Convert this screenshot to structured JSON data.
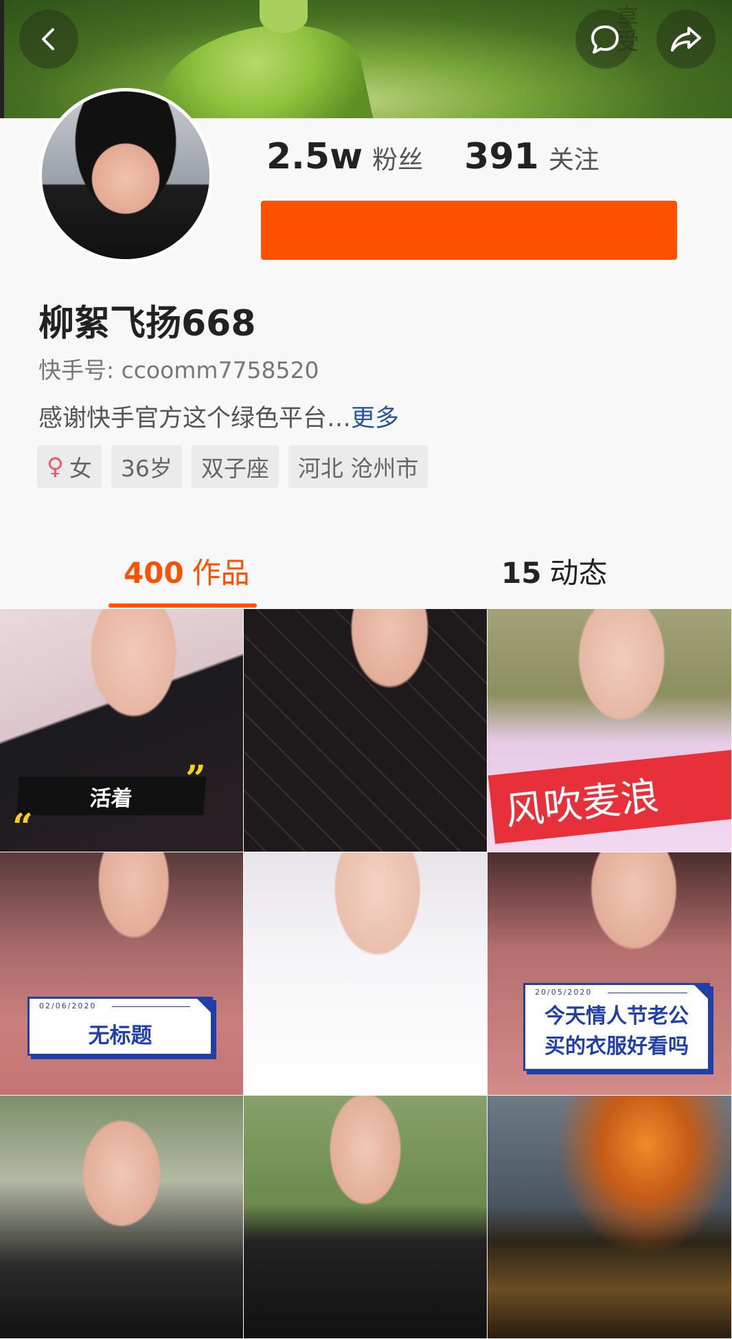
{
  "profile": {
    "fans_count": "2.5w",
    "fans_label": "粉丝",
    "following_count": "391",
    "following_label": "关注",
    "name": "柳絮飞扬668",
    "kuaishou_id": "快手号: ccoomm7758520",
    "bio": "感谢快手官方这个绿色平台…",
    "bio_more": "更多",
    "tags": {
      "gender": "女",
      "age": "36岁",
      "zodiac": "双子座",
      "location": "河北 沧州市"
    }
  },
  "banner_text": "享受",
  "tabs": [
    {
      "count": "400",
      "label": "作品"
    },
    {
      "count": "15",
      "label": "动态"
    }
  ],
  "works": {
    "caption_1": "活着",
    "caption_3": "风吹麦浪",
    "card_4_date": "02/06/2020",
    "card_4_text": "无标题",
    "card_6_date": "20/05/2020",
    "card_6_line1": "今天情人节老公",
    "card_6_line2": "买的衣服好看吗"
  },
  "colors": {
    "accent": "#fe5100",
    "link": "#27549a",
    "card_blue": "#1f40a8"
  }
}
